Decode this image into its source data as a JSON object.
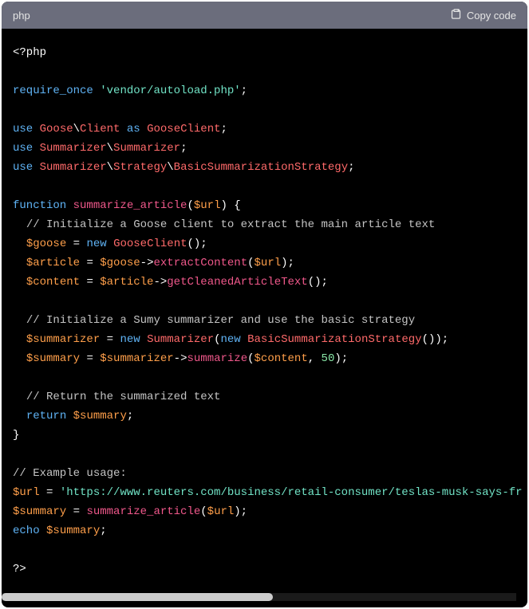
{
  "header": {
    "language": "php",
    "copy_label": "Copy code"
  },
  "code": {
    "tag_open": "<?php",
    "require_once": "require_once",
    "autoload_str": "'vendor/autoload.php'",
    "use": "use",
    "goose_ns": "Goose",
    "client": "Client",
    "as": "as",
    "goose_client": "GooseClient",
    "summ_ns": "Summarizer",
    "summ_class": "Summarizer",
    "strategy_ns": "Strategy",
    "basic_strat": "BasicSummarizationStrategy",
    "function": "function",
    "summ_article": "summarize_article",
    "url_var": "$url",
    "comment_goose": "// Initialize a Goose client to extract the main article text",
    "goose_var": "$goose",
    "new": "new",
    "article_var": "$article",
    "extract_content": "extractContent",
    "content_var": "$content",
    "get_cleaned": "getCleanedArticleText",
    "comment_sumy": "// Initialize a Sumy summarizer and use the basic strategy",
    "summarizer_var": "$summarizer",
    "summary_var": "$summary",
    "summarize": "summarize",
    "num_50": "50",
    "comment_return": "// Return the summarized text",
    "return": "return",
    "comment_example": "// Example usage:",
    "url_string": "'https://www.reuters.com/business/retail-consumer/teslas-musk-says-fr",
    "echo": "echo",
    "tag_close": "?>"
  }
}
